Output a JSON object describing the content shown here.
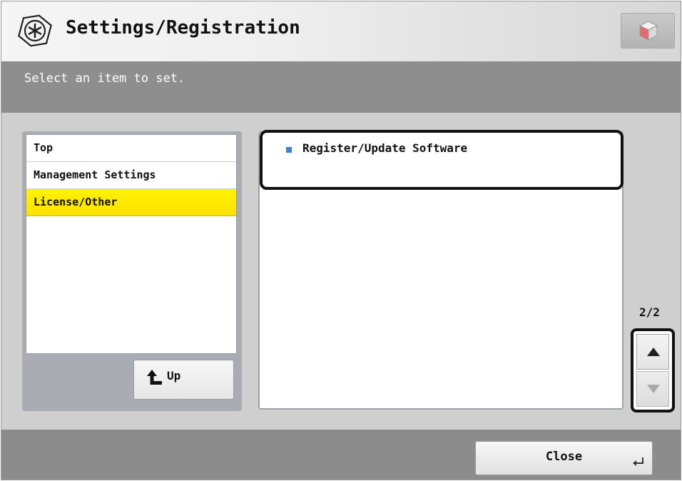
{
  "header": {
    "title": "Settings/Registration",
    "icon": "settings-asterisk-icon",
    "side_button_icon": "cube-icon"
  },
  "instruction": "Select an item to set.",
  "left_menu": {
    "items": [
      {
        "label": "Top",
        "selected": false
      },
      {
        "label": "Management Settings",
        "selected": false
      },
      {
        "label": "License/Other",
        "selected": true
      }
    ],
    "up_button": {
      "label": "Up",
      "icon": "up-arrow-icon"
    }
  },
  "right_list": {
    "items": [
      {
        "label": "Register/Update Software",
        "icon": "bullet-square-icon"
      }
    ]
  },
  "pager": {
    "label": "2/2",
    "up_icon": "triangle-up-icon",
    "down_icon": "triangle-down-icon"
  },
  "footer": {
    "close_label": "Close",
    "close_icon": "enter-icon"
  },
  "colors": {
    "selected_item": "#fff200",
    "bullet": "#3d7fd1",
    "header_band": "#8e8e8e"
  }
}
